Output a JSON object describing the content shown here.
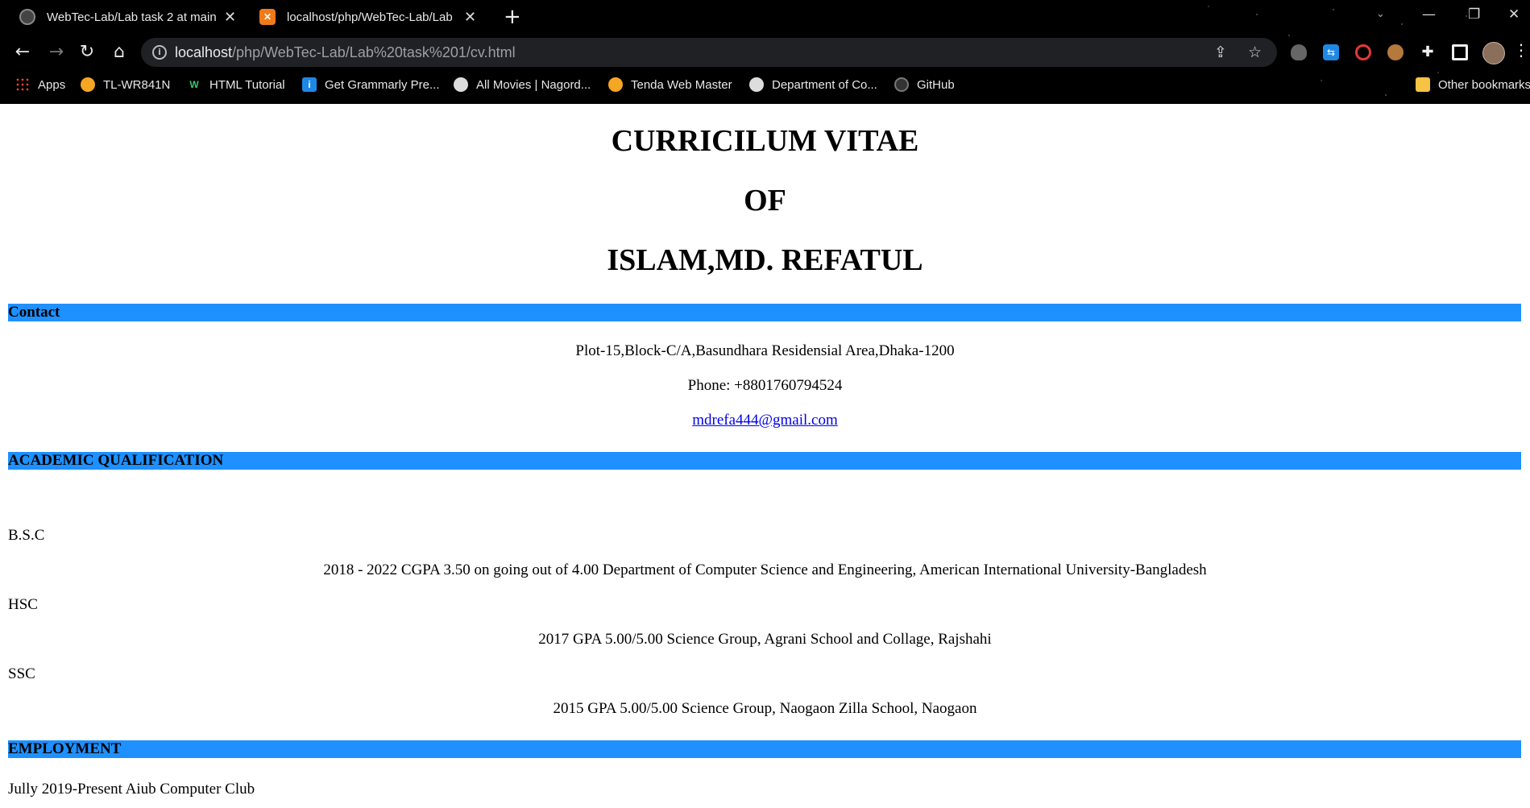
{
  "browser": {
    "tabs": [
      {
        "title": "WebTec-Lab/Lab task 2 at main · ",
        "icon": "github-icon"
      },
      {
        "title": "localhost/php/WebTec-Lab/Lab task",
        "icon": "xampp-icon"
      }
    ],
    "new_tab": "+",
    "url_host": "localhost",
    "url_path": "/php/WebTec-Lab/Lab%20task%201/cv.html",
    "bookmarks": [
      {
        "label": "Apps",
        "icon": "apps-grid-icon"
      },
      {
        "label": "TL-WR841N",
        "icon": "router-icon"
      },
      {
        "label": "HTML Tutorial",
        "icon": "w3schools-icon"
      },
      {
        "label": "Get Grammarly Pre...",
        "icon": "grammarly-icon"
      },
      {
        "label": "All Movies | Nagord...",
        "icon": "globe-icon"
      },
      {
        "label": "Tenda Web Master",
        "icon": "router-icon"
      },
      {
        "label": "Department of Co...",
        "icon": "globe-icon"
      },
      {
        "label": "GitHub",
        "icon": "github-icon"
      },
      {
        "label": "Other bookmarks",
        "icon": "folder-icon"
      }
    ]
  },
  "cv": {
    "heading_line1": "CURRICILUM VITAE",
    "heading_line2": "OF",
    "heading_line3": "ISLAM,MD. REFATUL",
    "contact": {
      "section": "Contact",
      "address": "Plot-15,Block-C/A,Basundhara Residensial Area,Dhaka-1200",
      "phone": "Phone: +8801760794524",
      "email": "mdrefa444@gmail.com"
    },
    "academic": {
      "section": "ACADEMIC QUALIFICATION",
      "items": [
        {
          "degree": "B.S.C",
          "detail": "2018 - 2022 CGPA 3.50 on going out of 4.00 Department of Computer Science and Engineering, American International University-Bangladesh"
        },
        {
          "degree": "HSC",
          "detail": "2017 GPA 5.00/5.00 Science Group, Agrani School and Collage, Rajshahi"
        },
        {
          "degree": "SSC",
          "detail": "2015 GPA 5.00/5.00 Science Group, Naogaon Zilla School, Naogaon"
        }
      ]
    },
    "employment": {
      "section": "EMPLOYMENT",
      "items": [
        "Jully 2019-Present Aiub Computer Club"
      ]
    }
  },
  "colors": {
    "section_bar": "#1e90ff",
    "link": "#0000ee",
    "chrome_bg": "#000000"
  }
}
